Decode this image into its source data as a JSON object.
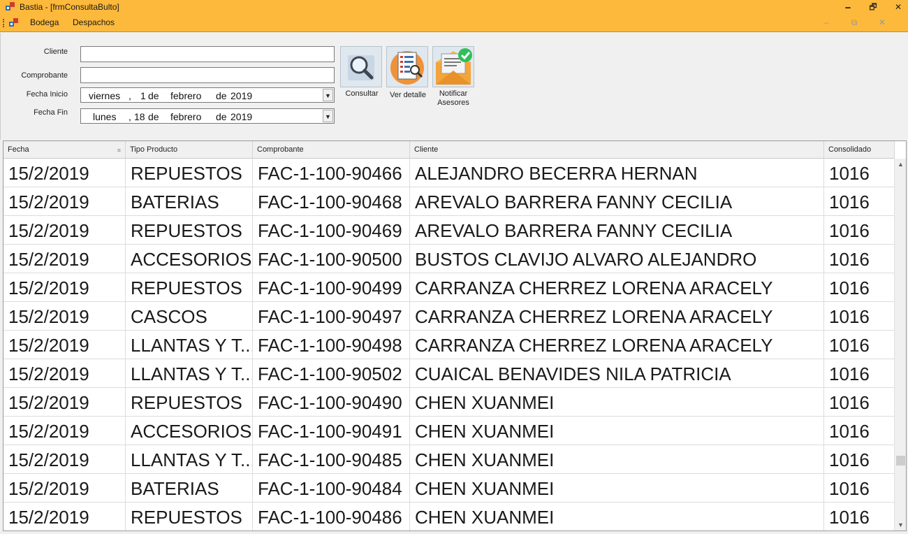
{
  "window": {
    "title": "Bastia - [frmConsultaBulto]",
    "minimize": "🗕",
    "restore": "🗗",
    "close": "✕"
  },
  "menu": {
    "items": [
      "Bodega",
      "Despachos"
    ],
    "mdi_minimize": "–",
    "mdi_restore": "⧉",
    "mdi_close": "✕"
  },
  "form": {
    "cliente_label": "Cliente",
    "cliente_value": "",
    "comprobante_label": "Comprobante",
    "comprobante_value": "",
    "fecha_inicio_label": "Fecha Inicio",
    "fecha_inicio": {
      "weekday": "viernes",
      "comma": ",",
      "day": "1",
      "de1": "de",
      "month": "febrero",
      "de2": "de",
      "year": "2019"
    },
    "fecha_fin_label": "Fecha Fin",
    "fecha_fin": {
      "weekday": "lunes",
      "comma": ",",
      "day": "18",
      "de1": "de",
      "month": "febrero",
      "de2": "de",
      "year": "2019"
    },
    "dropdown_arrow": "▼"
  },
  "toolbar": {
    "consultar_label": "Consultar",
    "ver_detalle_label": "Ver detalle",
    "notificar_line1": "Notificar",
    "notificar_line2": "Asesores"
  },
  "grid": {
    "columns": [
      "Fecha",
      "Tipo Producto",
      "Comprobante",
      "Cliente",
      "Consolidado"
    ],
    "sort_glyph": "≡",
    "rows": [
      [
        "15/2/2019",
        "REPUESTOS",
        "FAC-1-100-90466",
        "ALEJANDRO BECERRA HERNAN",
        "1016"
      ],
      [
        "15/2/2019",
        "BATERIAS",
        "FAC-1-100-90468",
        "AREVALO BARRERA FANNY CECILIA",
        "1016"
      ],
      [
        "15/2/2019",
        "REPUESTOS",
        "FAC-1-100-90469",
        "AREVALO BARRERA FANNY CECILIA",
        "1016"
      ],
      [
        "15/2/2019",
        "ACCESORIOS",
        "FAC-1-100-90500",
        "BUSTOS CLAVIJO ALVARO ALEJANDRO",
        "1016"
      ],
      [
        "15/2/2019",
        "REPUESTOS",
        "FAC-1-100-90499",
        "CARRANZA CHERREZ LORENA ARACELY",
        "1016"
      ],
      [
        "15/2/2019",
        "CASCOS",
        "FAC-1-100-90497",
        "CARRANZA CHERREZ LORENA ARACELY",
        "1016"
      ],
      [
        "15/2/2019",
        "LLANTAS Y T...",
        "FAC-1-100-90498",
        "CARRANZA CHERREZ LORENA ARACELY",
        "1016"
      ],
      [
        "15/2/2019",
        "LLANTAS Y T...",
        "FAC-1-100-90502",
        "CUAICAL BENAVIDES NILA PATRICIA",
        "1016"
      ],
      [
        "15/2/2019",
        "REPUESTOS",
        "FAC-1-100-90490",
        "CHEN XUANMEI",
        "1016"
      ],
      [
        "15/2/2019",
        "ACCESORIOS",
        "FAC-1-100-90491",
        "CHEN XUANMEI",
        "1016"
      ],
      [
        "15/2/2019",
        "LLANTAS Y T...",
        "FAC-1-100-90485",
        "CHEN XUANMEI",
        "1016"
      ],
      [
        "15/2/2019",
        "BATERIAS",
        "FAC-1-100-90484",
        "CHEN XUANMEI",
        "1016"
      ],
      [
        "15/2/2019",
        "REPUESTOS",
        "FAC-1-100-90486",
        "CHEN XUANMEI",
        "1016"
      ]
    ],
    "scroll_up": "▲",
    "scroll_down": "▼"
  },
  "colors": {
    "accent": "#fdb93b",
    "grid_bg": "#ffffff",
    "form_bg": "#f0f0f0"
  }
}
